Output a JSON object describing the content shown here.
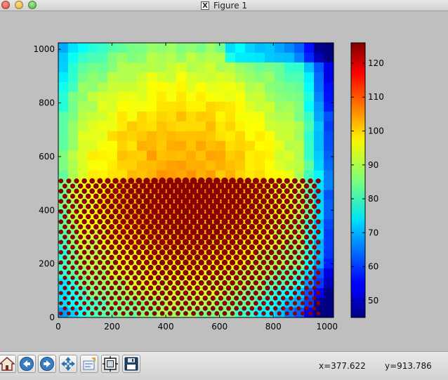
{
  "window": {
    "title": "Figure 1"
  },
  "toolbar": {
    "buttons": [
      {
        "name": "home-button",
        "icon": "home-icon"
      },
      {
        "name": "back-button",
        "icon": "arrow-left-icon"
      },
      {
        "name": "forward-button",
        "icon": "arrow-right-icon"
      },
      {
        "name": "pan-button",
        "icon": "move-icon"
      },
      {
        "name": "zoom-button",
        "icon": "zoom-rect-icon"
      },
      {
        "name": "subplots-button",
        "icon": "subplots-icon"
      },
      {
        "name": "save-button",
        "icon": "floppy-disk-icon"
      }
    ],
    "x_readout": "x=377.622",
    "y_readout": "y=913.786"
  },
  "chart_data": {
    "type": "heatmap",
    "title": "",
    "xlabel": "",
    "ylabel": "",
    "xlim": [
      0,
      1024
    ],
    "ylim": [
      0,
      1024
    ],
    "x_ticks": [
      "0",
      "200",
      "400",
      "600",
      "800",
      "1000"
    ],
    "y_ticks": [
      "0",
      "200",
      "400",
      "600",
      "800",
      "1000"
    ],
    "x_tick_values": [
      0,
      200,
      400,
      600,
      800,
      1000
    ],
    "y_tick_values": [
      0,
      200,
      400,
      600,
      800,
      1000
    ],
    "colormap": "jet",
    "colorbar": {
      "range": [
        45,
        126
      ],
      "ticks": [
        "50",
        "60",
        "70",
        "80",
        "90",
        "100",
        "110",
        "120"
      ],
      "tick_values": [
        50,
        60,
        70,
        80,
        90,
        100,
        110,
        120
      ]
    },
    "grid": false,
    "description_values": {
      "background_level_center": 100,
      "background_level_edge": 65,
      "spot_level": 126,
      "lattice": "hexagonal array of bright spots",
      "spot_pitch_x": 29,
      "spot_pitch_y": 38
    }
  },
  "colors": {
    "window_bg": "#bfbfbf",
    "toolbar_icon_blue": "#2a6fb0"
  }
}
